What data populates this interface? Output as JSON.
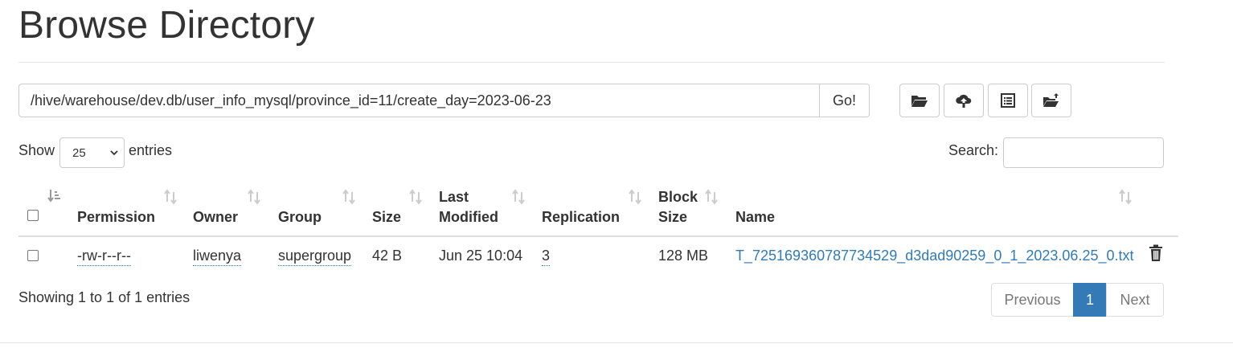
{
  "page": {
    "title": "Browse Directory"
  },
  "path_bar": {
    "value": "/hive/warehouse/dev.db/user_info_mysql/province_id=11/create_day=2023-06-23",
    "go_label": "Go!"
  },
  "toolbar": {
    "buttons": [
      {
        "icon": "folder-open-icon"
      },
      {
        "icon": "cloud-upload-icon"
      },
      {
        "icon": "list-alt-icon"
      },
      {
        "icon": "folder-upload-icon"
      }
    ]
  },
  "length_control": {
    "show_label": "Show",
    "selected": "25",
    "entries_label": "entries"
  },
  "search": {
    "label": "Search:",
    "value": ""
  },
  "table": {
    "columns": {
      "permission": "Permission",
      "owner": "Owner",
      "group": "Group",
      "size": "Size",
      "last_modified_1": "Last",
      "last_modified_2": "Modified",
      "replication": "Replication",
      "block_size_1": "Block",
      "block_size_2": "Size",
      "name": "Name"
    },
    "rows": [
      {
        "permission": "-rw-r--r--",
        "owner": "liwenya",
        "group": "supergroup",
        "size": "42 B",
        "last_modified": "Jun 25 10:04",
        "replication": "3",
        "block_size": "128 MB",
        "name": "T_725169360787734529_d3dad90259_0_1_2023.06.25_0.txt"
      }
    ]
  },
  "footer": {
    "info": "Showing 1 to 1 of 1 entries",
    "pagination": {
      "previous": "Previous",
      "current": "1",
      "next": "Next"
    }
  },
  "colors": {
    "link": "#337ab7",
    "border": "#cccccc",
    "text": "#333333"
  }
}
